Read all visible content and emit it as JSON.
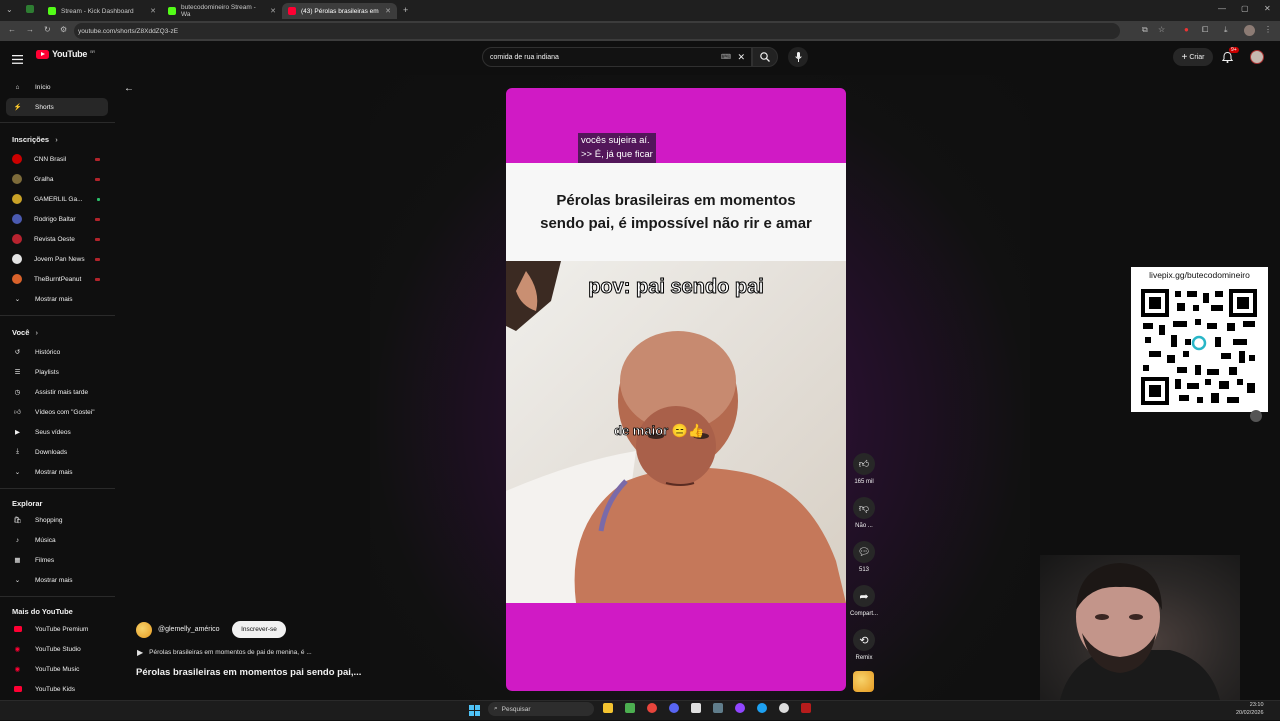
{
  "browser": {
    "tabs": [
      {
        "label": "Stream - Kick Dashboard",
        "color": "#53fc18"
      },
      {
        "label": "butecodomineiro Stream - Wa",
        "color": "#53fc18"
      },
      {
        "label": "(43) Pérolas brasileiras em",
        "color": "#ff0033"
      }
    ],
    "url": "youtube.com/shorts/Z8XddZQ3-zE"
  },
  "header": {
    "brand": "YouTube",
    "brand_region": "BR",
    "search_value": "comida de rua indiana",
    "create_label": "Criar",
    "notif_count": "9+"
  },
  "sidebar": {
    "main": [
      {
        "label": "Início",
        "icon": "home-icon"
      },
      {
        "label": "Shorts",
        "icon": "shorts-icon"
      }
    ],
    "subs_title": "Inscrições",
    "subs": [
      {
        "label": "CNN Brasil",
        "color": "#cc0000"
      },
      {
        "label": "Gralha",
        "color": "#7d6b3a"
      },
      {
        "label": "GAMERLIL Ga...",
        "color": "#c9a227"
      },
      {
        "label": "Rodrigo Baltar",
        "color": "#4b5ab0"
      },
      {
        "label": "Revista Oeste",
        "color": "#b8232f"
      },
      {
        "label": "Jovem Pan News",
        "color": "#e4e4e4"
      },
      {
        "label": "TheBurntPeanut",
        "color": "#d9622b"
      }
    ],
    "subs_more": "Mostrar mais",
    "you_title": "Você",
    "you": [
      {
        "label": "Histórico"
      },
      {
        "label": "Playlists"
      },
      {
        "label": "Assistir mais tarde"
      },
      {
        "label": "Vídeos com \"Gostei\""
      },
      {
        "label": "Seus vídeos"
      },
      {
        "label": "Downloads"
      },
      {
        "label": "Mostrar mais"
      }
    ],
    "explore_title": "Explorar",
    "explore": [
      {
        "label": "Shopping"
      },
      {
        "label": "Música"
      },
      {
        "label": "Filmes"
      },
      {
        "label": "Mostrar mais"
      }
    ],
    "more_title": "Mais do YouTube",
    "more": [
      {
        "label": "YouTube Premium"
      },
      {
        "label": "YouTube Studio"
      },
      {
        "label": "YouTube Music"
      },
      {
        "label": "YouTube Kids"
      }
    ]
  },
  "short": {
    "caption_line1": "vocês sujeira aí.",
    "caption_line2": ">> É, já que ficar",
    "title_card": "Pérolas brasileiras em momentos sendo pai, é impossível não rir e amar",
    "overlay_top": "pov: pai sendo pai",
    "overlay_mid": "de maior 😑👍",
    "accent": "#d01ac5"
  },
  "actions": {
    "like_count": "165 mil",
    "dislike_label": "Não ...",
    "comments_count": "513",
    "share_label": "Compart...",
    "remix_label": "Remix"
  },
  "channel": {
    "handle": "@glemelly_américo",
    "subscribe_label": "Inscrever-se",
    "related_label": "Pérolas brasileiras em momentos de pai de menina, é ...",
    "video_title": "Pérolas brasileiras em momentos pai sendo pai,..."
  },
  "stream_overlay": {
    "qr_label": "livepix.gg/butecodomineiro"
  },
  "taskbar": {
    "search_placeholder": "Pesquisar",
    "time": "23:10",
    "date": "20/02/2026"
  }
}
